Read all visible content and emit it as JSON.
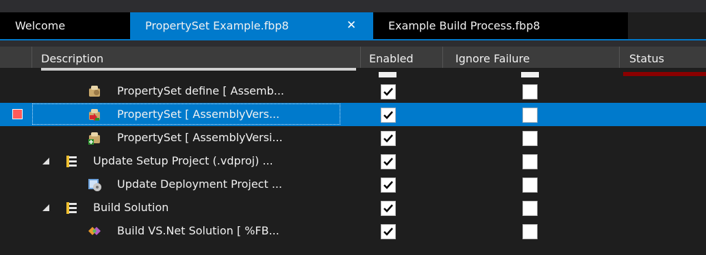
{
  "tabs": [
    {
      "label": "Welcome"
    },
    {
      "label": "PropertySet Example.fbp8",
      "close": "✕"
    },
    {
      "label": "Example Build Process.fbp8"
    }
  ],
  "columns": {
    "description": "Description",
    "enabled": "Enabled",
    "ignore_failure": "Ignore Failure",
    "status": "Status"
  },
  "rows": [
    {
      "label": "PropertySet define [ Assemb...",
      "icon": "property-set-icon",
      "enabled": true,
      "ignore_failure": false
    },
    {
      "label": "PropertySet  [ AssemblyVers...",
      "icon": "property-set-arrow-icon",
      "enabled": true,
      "ignore_failure": false,
      "selected": true,
      "breakpoint": true
    },
    {
      "label": "PropertySet [ AssemblyVersi...",
      "icon": "property-set-plus-icon",
      "enabled": true,
      "ignore_failure": false
    },
    {
      "label": "Update Setup Project (.vdproj) ...",
      "icon": "group-icon",
      "enabled": true,
      "ignore_failure": false,
      "expanded": true
    },
    {
      "label": "Update Deployment Project ...",
      "icon": "deployment-project-icon",
      "enabled": true,
      "ignore_failure": false
    },
    {
      "label": "Build Solution",
      "icon": "group-icon",
      "enabled": true,
      "ignore_failure": false,
      "expanded": true
    },
    {
      "label": "Build VS.Net Solution [ %FB...",
      "icon": "vs-solution-icon",
      "enabled": true,
      "ignore_failure": false
    }
  ],
  "colors": {
    "accent": "#007acc",
    "background": "#1e1e1e",
    "header": "#3c3c3c",
    "breakpoint": "#ff5a5a",
    "status_bar": "#8b0000"
  }
}
